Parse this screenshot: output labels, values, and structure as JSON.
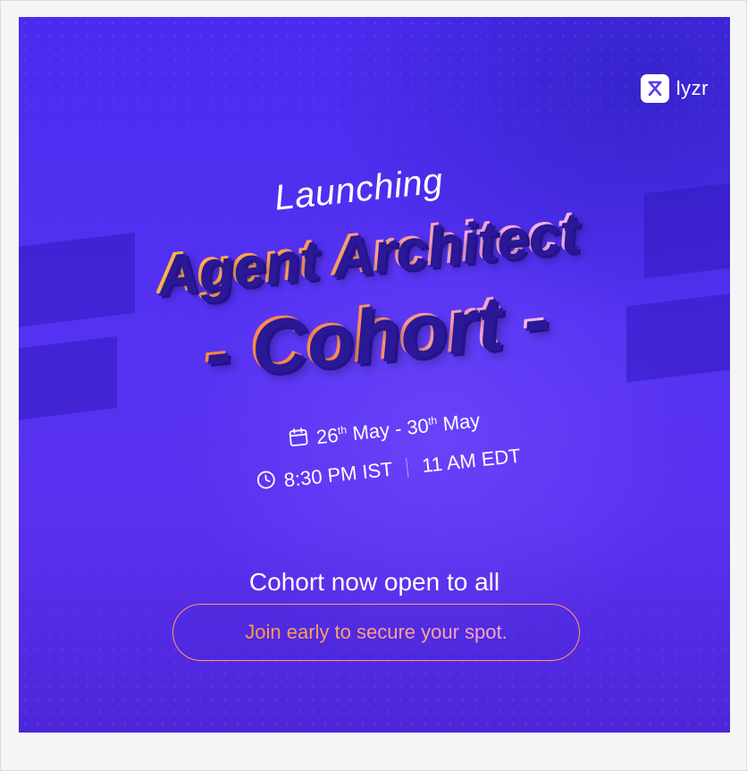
{
  "brand": {
    "name": "lyzr",
    "icon": "lyzr-logo-icon"
  },
  "headline": {
    "kicker": "Launching",
    "title_line1": "Agent Architect",
    "title_line2": "- Cohort -"
  },
  "schedule": {
    "date_icon": "calendar-icon",
    "start_day": "26",
    "start_suffix": "th",
    "start_month": "May",
    "date_separator": "-",
    "end_day": "30",
    "end_suffix": "th",
    "end_month": "May",
    "time_icon": "clock-icon",
    "time_ist": "8:30 PM IST",
    "time_edt": "11 AM EDT"
  },
  "announcement": "Cohort now open to all",
  "cta": {
    "label": "Join early to secure your spot."
  },
  "colors": {
    "background": "#5532f2",
    "accent_orange": "#ff8a3d",
    "accent_pink": "#f3a6d8",
    "text": "#ffffff"
  }
}
